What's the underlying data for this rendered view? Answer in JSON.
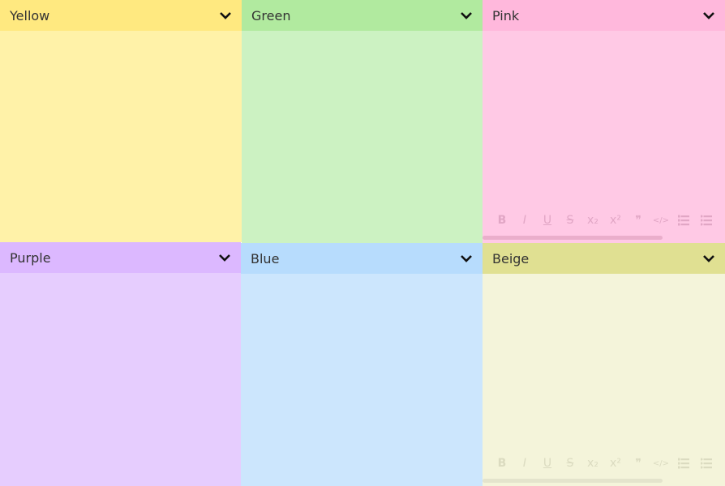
{
  "notes": [
    {
      "id": "yellow",
      "title": "Yellow",
      "color_header": "#ffe980",
      "color_body": "#fff2a8"
    },
    {
      "id": "green",
      "title": "Green",
      "color_header": "#b1ea9f",
      "color_body": "#ccf2c2"
    },
    {
      "id": "pink",
      "title": "Pink",
      "color_header": "#ffb8dc",
      "color_body": "#ffc9e5"
    },
    {
      "id": "purple",
      "title": "Purple",
      "color_header": "#dcb8ff",
      "color_body": "#e6cdfe"
    },
    {
      "id": "blue",
      "title": "Blue",
      "color_header": "#b7dcfd",
      "color_body": "#cce6fd"
    },
    {
      "id": "beige",
      "title": "Beige",
      "color_header": "#e0e092",
      "color_body": "#f4f4da"
    }
  ],
  "toolbar": {
    "bold": "B",
    "italic": "I",
    "underline": "U",
    "strikethrough": "S",
    "subscript": "x₂",
    "superscript": "x²",
    "quote": "❞",
    "code": "</>"
  },
  "icons": {
    "collapse": "chevron-down-icon",
    "numbered_list": "numbered-list-icon",
    "bullet_list": "bullet-list-icon"
  }
}
